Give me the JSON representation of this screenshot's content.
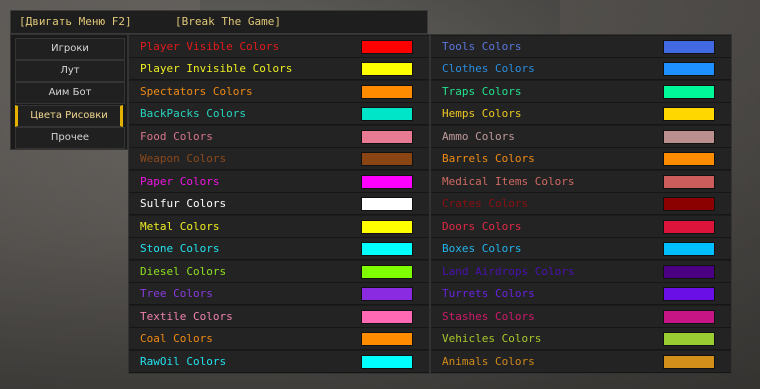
{
  "header": {
    "move_menu": "[Двигать Меню F2]",
    "title": "[Break The Game]"
  },
  "nav": [
    {
      "label": "Игроки",
      "active": false
    },
    {
      "label": "Лут",
      "active": false
    },
    {
      "label": "Аим Бот",
      "active": false
    },
    {
      "label": "Цвета Рисовки",
      "active": true
    },
    {
      "label": "Прочее",
      "active": false
    }
  ],
  "left_rows": [
    {
      "label": "Player Visible Colors",
      "text_color": "#e21b1b",
      "swatch": "#ff0000"
    },
    {
      "label": "Player Invisible Colors",
      "text_color": "#eeee22",
      "swatch": "#ffff00"
    },
    {
      "label": "Spectators Colors",
      "text_color": "#f08a14",
      "swatch": "#ff8c00"
    },
    {
      "label": "BackPacks Colors",
      "text_color": "#26d6c0",
      "swatch": "#00e5c8"
    },
    {
      "label": "Food Colors",
      "text_color": "#d6758c",
      "swatch": "#e87b93"
    },
    {
      "label": "Weapon Colors",
      "text_color": "#8a4a1c",
      "swatch": "#8b4513"
    },
    {
      "label": "Paper Colors",
      "text_color": "#ee16e2",
      "swatch": "#ff00ff"
    },
    {
      "label": "Sulfur Colors",
      "text_color": "#ffffff",
      "swatch": "#ffffff"
    },
    {
      "label": "Metal Colors",
      "text_color": "#eeee22",
      "swatch": "#ffff00"
    },
    {
      "label": "Stone Colors",
      "text_color": "#22e2ee",
      "swatch": "#00ffff"
    },
    {
      "label": "Diesel Colors",
      "text_color": "#8ee222",
      "swatch": "#7fff00"
    },
    {
      "label": "Tree Colors",
      "text_color": "#8a3ae0",
      "swatch": "#8a2be2"
    },
    {
      "label": "Textile Colors",
      "text_color": "#ee82b0",
      "swatch": "#ff69b4"
    },
    {
      "label": "Coal Colors",
      "text_color": "#f08a14",
      "swatch": "#ff8c00"
    },
    {
      "label": "RawOil Colors",
      "text_color": "#22e2ee",
      "swatch": "#00ffff"
    }
  ],
  "right_rows": [
    {
      "label": "Tools Colors",
      "text_color": "#5a78e0",
      "swatch": "#4169e1"
    },
    {
      "label": "Clothes Colors",
      "text_color": "#2a8ee0",
      "swatch": "#1e90ff"
    },
    {
      "label": "Traps Colors",
      "text_color": "#22e28e",
      "swatch": "#00fa9a"
    },
    {
      "label": "Hemps Colors",
      "text_color": "#eec822",
      "swatch": "#ffd700"
    },
    {
      "label": "Ammo Colors",
      "text_color": "#c09a9a",
      "swatch": "#bc8f8f"
    },
    {
      "label": "Barrels Colors",
      "text_color": "#f08a14",
      "swatch": "#ff8c00"
    },
    {
      "label": "Medical Items Colors",
      "text_color": "#d06a62",
      "swatch": "#cd5c5c"
    },
    {
      "label": "Crates Colors",
      "text_color": "#8b1010",
      "swatch": "#8b0000"
    },
    {
      "label": "Doors Colors",
      "text_color": "#e02a48",
      "swatch": "#dc143c"
    },
    {
      "label": "Boxes Colors",
      "text_color": "#22b4ee",
      "swatch": "#00bfff"
    },
    {
      "label": "Land Airdrops Colors",
      "text_color": "#4a10b0",
      "swatch": "#4b0082"
    },
    {
      "label": "Turrets Colors",
      "text_color": "#6a22e0",
      "swatch": "#6a0fe6"
    },
    {
      "label": "Stashes Colors",
      "text_color": "#d01a6a",
      "swatch": "#c71585"
    },
    {
      "label": "Vehicles Colors",
      "text_color": "#a8c82a",
      "swatch": "#9acd32"
    },
    {
      "label": "Animals Colors",
      "text_color": "#d08a1a",
      "swatch": "#d2901a"
    }
  ]
}
